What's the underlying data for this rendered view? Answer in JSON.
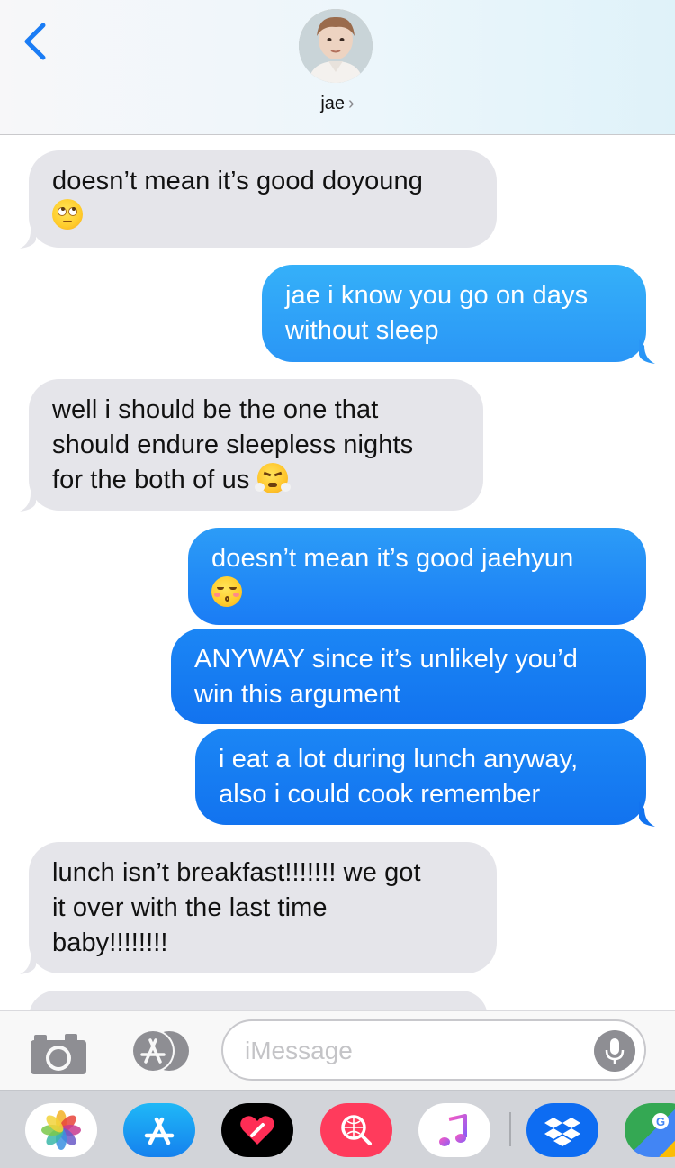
{
  "header": {
    "contact_name": "jae",
    "chevron": "›",
    "back_icon": "chevron-left-icon",
    "avatar_icon": "contact-avatar"
  },
  "messages": [
    {
      "direction": "received",
      "text": "doesn’t mean it’s good doyoung",
      "emoji": "face-with-rolling-eyes"
    },
    {
      "direction": "sent",
      "text_lines": [
        "jae i know you go on days",
        "without sleep"
      ]
    },
    {
      "direction": "received",
      "text_lines": [
        "well i should be the one that",
        "should endure sleepless nights",
        "for the both of us"
      ],
      "emoji": "face-with-steam-from-nose"
    },
    {
      "direction": "sent",
      "text": "doesn’t mean it’s good jaehyun",
      "emoji": "kissing-face-with-closed-eyes"
    },
    {
      "direction": "sent",
      "text_lines": [
        "ANYWAY since it’s unlikely you’d",
        "win this argument"
      ]
    },
    {
      "direction": "sent",
      "text_lines": [
        "i eat a lot during lunch anyway,",
        "also i could cook remember"
      ]
    },
    {
      "direction": "received",
      "text_lines": [
        "lunch isn’t breakfast!!!!!!! we got",
        "it over with the last time",
        "baby!!!!!!!!"
      ]
    }
  ],
  "input": {
    "placeholder": "iMessage",
    "camera_icon": "camera-icon",
    "apps_icon": "app-store-icon",
    "mic_icon": "microphone-icon"
  },
  "drawer": {
    "apps": [
      "photos-icon",
      "app-store-icon",
      "digital-touch-icon",
      "web-images-search-icon",
      "music-icon",
      "dropbox-icon",
      "google-maps-icon"
    ]
  },
  "colors": {
    "sent_bubble": "#1a7cf5",
    "received_bubble": "#e5e5ea",
    "accent": "#1a7cf5"
  }
}
